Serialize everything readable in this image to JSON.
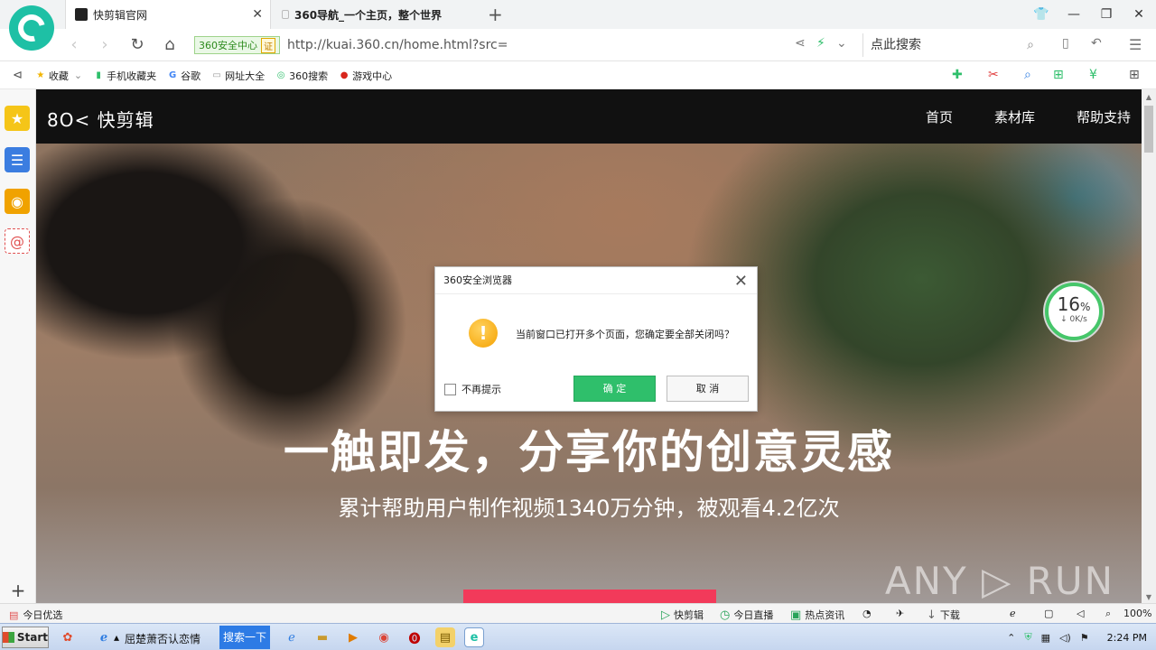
{
  "browser": {
    "tabs": [
      {
        "title": "快剪辑官网",
        "active": true
      },
      {
        "title": "360导航_一个主页，整个世界",
        "active": false
      }
    ],
    "address": {
      "security_label": "360安全中心",
      "security_mark": "证",
      "url": "http://kuai.360.cn/home.html?src="
    },
    "search_placeholder": "点此搜索",
    "bookmarks": [
      {
        "label": "收藏",
        "icon": "star-icon"
      },
      {
        "label": "手机收藏夹",
        "icon": "phone-icon"
      },
      {
        "label": "谷歌",
        "icon": "google-icon"
      },
      {
        "label": "网址大全",
        "icon": "page-icon"
      },
      {
        "label": "360搜索",
        "icon": "360-search-icon"
      },
      {
        "label": "游戏中心",
        "icon": "game-center-icon"
      }
    ]
  },
  "site": {
    "logo": "8O< 快剪辑",
    "nav": [
      "首页",
      "素材库",
      "帮助支持"
    ],
    "hero_title": "一触即发，分享你的创意灵感",
    "hero_subtitle": "累计帮助用户制作视频1340万分钟，被观看4.2亿次",
    "watermark": "ANY ▷ RUN"
  },
  "speed_widget": {
    "percent": "16",
    "percent_unit": "%",
    "rate": "↓ 0K/s"
  },
  "dialog": {
    "title": "360安全浏览器",
    "message": "当前窗口已打开多个页面，您确定要全部关闭吗？",
    "checkbox_label": "不再提示",
    "ok_label": "确 定",
    "cancel_label": "取 消"
  },
  "statusbar": {
    "left_label": "今日优选",
    "items": [
      "快剪辑",
      "今日直播",
      "热点资讯",
      "下载"
    ],
    "zoom": "100%"
  },
  "taskbar": {
    "start_label": "Start",
    "ie_window_label": "屈楚萧否认恋情",
    "search_button": "搜索一下",
    "clock": "2:24 PM"
  },
  "colors": {
    "accent_green": "#2fbf6b",
    "hero_button": "#f23a5a",
    "site_nav_bg": "#111111"
  }
}
